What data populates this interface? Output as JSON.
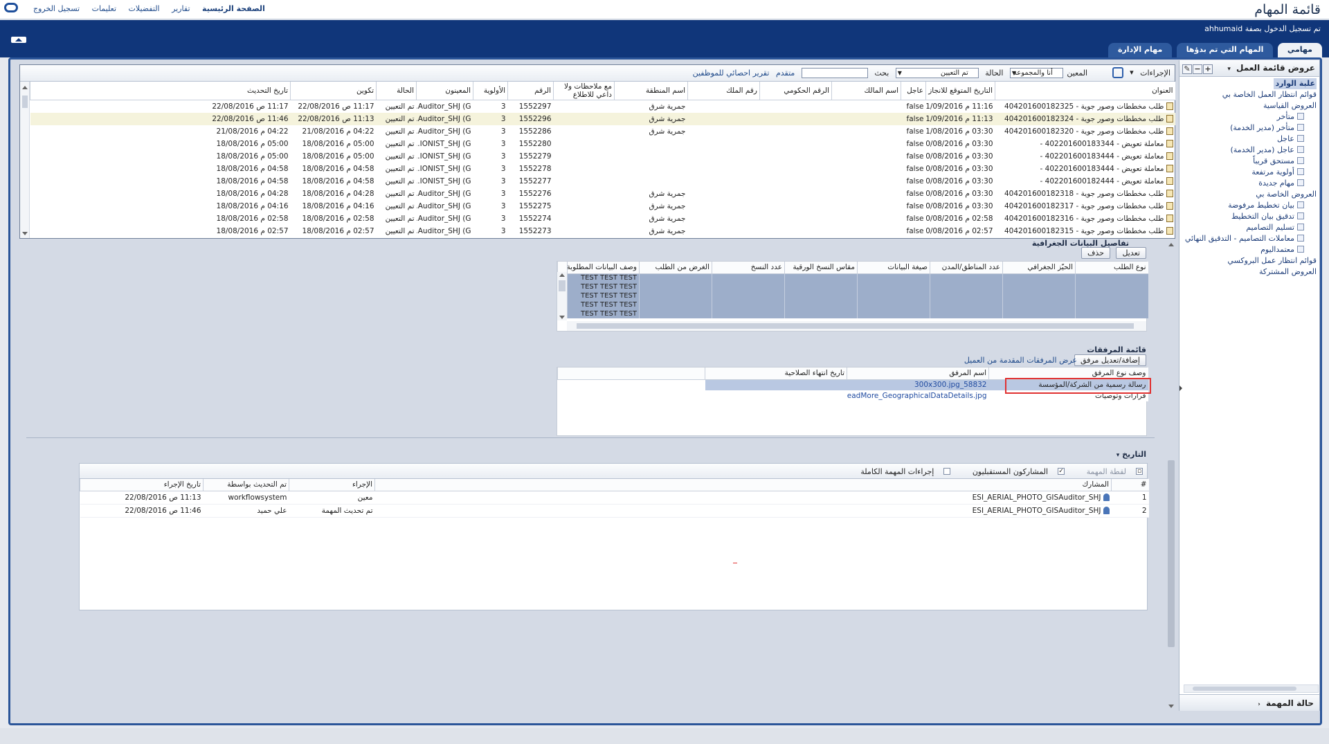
{
  "header": {
    "app_title": "قائمة المهام",
    "nav": [
      "الصفحة الرئيسية",
      "تقارير",
      "التفضيلات",
      "تعليمات",
      "تسجيل الخروج"
    ],
    "login_text": "تم تسجيل الدخول بصفة ahhumaid"
  },
  "tabs": [
    "مهامي",
    "المهام التي تم بدؤها",
    "مهام الإدارة"
  ],
  "right_panel": {
    "title": "عروض قائمة العمل",
    "inbox": "علبة الوارد",
    "my_work_queues": "قوائم انتظار العمل الخاصة بي",
    "standard_views": "العروض القياسية",
    "standard_items": [
      "متأخر",
      "متأخر (مدير الخدمة)",
      "عاجل",
      "عاجل (مدير الخدمة)",
      "مستحق قريباً",
      "أولوية مرتفعة",
      "مهام جديدة"
    ],
    "my_views": "العروض الخاصة بي",
    "my_items": [
      "بيان تخطيط مرفوضة",
      "تدقيق بيان التخطيط",
      "تسليم التصاميم",
      "معاملات التصاميم - التدقيق النهائي",
      "معتمداليوم"
    ],
    "proxy_queues": "قوائم انتظار عمل البروكسي",
    "shared_views": "العروض المشتركة",
    "footer": "حالة المهمة"
  },
  "task_toolbar": {
    "actions": "الإجراءات",
    "assignee_label": "المعين",
    "assignee_value": "أنا والمجموعة",
    "status_label": "الحالة",
    "status_value": "تم التعيين",
    "search_label": "بحث",
    "advanced": "متقدم",
    "stats_report": "تقرير احصائي للموظفين"
  },
  "task_columns": [
    "العنوان",
    "التاريخ المتوقع للانجاز",
    "عاجل",
    "اسم المالك",
    "الرقم الحكومي",
    "رقم الملك",
    "اسم المنطقة",
    "مع ملاحظات ولا داعي للاطلاع",
    "الرقم",
    "الأولوية",
    "المعينون",
    "الحالة",
    "تكوين",
    "تاريخ التحديث"
  ],
  "tasks": [
    [
      "طلب مخططات وصور جوية - 404201600182325",
      "11:16 م 01/09/2016",
      "false",
      "",
      "",
      "",
      "جمرية شرق",
      "",
      "1552297",
      "3",
      "Auditor_SHJ (G...",
      "تم التعيين",
      "11:17 ص 22/08/2016",
      "11:17 ص 22/08/2016"
    ],
    [
      "طلب مخططات وصور جوية - 404201600182324",
      "11:13 م 01/09/2016",
      "false",
      "",
      "",
      "",
      "جمرية شرق",
      "",
      "1552296",
      "3",
      "Auditor_SHJ (G...",
      "تم التعيين",
      "11:13 ص 22/08/2016",
      "11:46 ص 22/08/2016"
    ],
    [
      "طلب مخططات وصور جوية - 404201600182320",
      "03:30 م 31/08/2016",
      "false",
      "",
      "",
      "",
      "جمرية شرق",
      "",
      "1552286",
      "3",
      "Auditor_SHJ (G...",
      "تم التعيين",
      "04:22 م 21/08/2016",
      "04:22 م 21/08/2016"
    ],
    [
      "معاملة تعويض - 402201600183344 -",
      "03:30 م 30/08/2016",
      "false",
      "",
      "",
      "",
      "",
      "",
      "1552280",
      "3",
      "IONIST_SHJ (G...",
      "تم التعيين",
      "05:00 م 18/08/2016",
      "05:00 م 18/08/2016"
    ],
    [
      "معاملة تعويض - 402201600183444 -",
      "03:30 م 30/08/2016",
      "false",
      "",
      "",
      "",
      "",
      "",
      "1552279",
      "3",
      "IONIST_SHJ (G...",
      "تم التعيين",
      "05:00 م 18/08/2016",
      "05:00 م 18/08/2016"
    ],
    [
      "معاملة تعويض - 402201600183444 -",
      "03:30 م 30/08/2016",
      "false",
      "",
      "",
      "",
      "",
      "",
      "1552278",
      "3",
      "IONIST_SHJ (G...",
      "تم التعيين",
      "04:58 م 18/08/2016",
      "04:58 م 18/08/2016"
    ],
    [
      "معاملة تعويض - 402201600182444 -",
      "03:30 م 30/08/2016",
      "false",
      "",
      "",
      "",
      "",
      "",
      "1552277",
      "3",
      "IONIST_SHJ (G...",
      "تم التعيين",
      "04:58 م 18/08/2016",
      "04:58 م 18/08/2016"
    ],
    [
      "طلب مخططات وصور جوية - 404201600182318",
      "03:30 م 30/08/2016",
      "false",
      "",
      "",
      "",
      "جمرية شرق",
      "",
      "1552276",
      "3",
      "Auditor_SHJ (G...",
      "تم التعيين",
      "04:28 م 18/08/2016",
      "04:28 م 18/08/2016"
    ],
    [
      "طلب مخططات وصور جوية - 404201600182317",
      "03:30 م 30/08/2016",
      "false",
      "",
      "",
      "",
      "جمرية شرق",
      "",
      "1552275",
      "3",
      "Auditor_SHJ (G...",
      "تم التعيين",
      "04:16 م 18/08/2016",
      "04:16 م 18/08/2016"
    ],
    [
      "طلب مخططات وصور جوية - 404201600182316",
      "02:58 م 30/08/2016",
      "false",
      "",
      "",
      "",
      "جمرية شرق",
      "",
      "1552274",
      "3",
      "Auditor_SHJ (G...",
      "تم التعيين",
      "02:58 م 18/08/2016",
      "02:58 م 18/08/2016"
    ],
    [
      "طلب مخططات وصور جوية - 404201600182315",
      "02:57 م 30/08/2016",
      "false",
      "",
      "",
      "",
      "جمرية شرق",
      "",
      "1552273",
      "3",
      "Auditor_SHJ (G...",
      "تم التعيين",
      "02:57 م 18/08/2016",
      "02:57 م 18/08/2016"
    ]
  ],
  "geo": {
    "title": "تفاصيل البيانات الجغرافية",
    "edit": "تعديل",
    "delete": "حذف",
    "columns": [
      "نوع الطلب",
      "الحيّز الجغرافي",
      "عدد المناطق/المدن",
      "صيغة البيانات",
      "مقاس النسخ الورقية",
      "عدد النسخ",
      "الغرض من الطلب",
      "وصف البيانات المطلوبة"
    ],
    "rows": [
      "TEST TEST TEST",
      "TEST TEST TEST",
      "TEST TEST TEST",
      "TEST TEST TEST",
      "TEST TEST TEST"
    ]
  },
  "attachments": {
    "title": "قائمة المرفقات",
    "add_btn": "إضافة/تعديل مرفق",
    "client_link": "عرض المرفقات المقدمة من العميل",
    "columns": [
      "وصف نوع المرفق",
      "اسم المرفق",
      "تاريخ انتهاء الصلاحية"
    ],
    "rows": [
      [
        "رسالة رسمية من الشركة/المؤسسة",
        "300x300.jpg_58832",
        ""
      ],
      [
        "قرارات وتوصيات",
        "ReadMore_GeographicalDataDetails.jpg",
        ""
      ]
    ]
  },
  "history": {
    "title": "التاريخ",
    "snapshot": "لقطة المهمة",
    "future": "المشاركون المستقبليون",
    "full_actions": "إجراءات المهمة الكاملة",
    "columns": [
      "#",
      "المشارك",
      "الإجراء",
      "تم التحديث بواسطة",
      "تاريخ الإجراء"
    ],
    "rows": [
      [
        "1",
        "ESI_AERIAL_PHOTO_GISAuditor_SHJ",
        "معين",
        "workflowsystem",
        "11:13 ص 22/08/2016"
      ],
      [
        "2",
        "ESI_AERIAL_PHOTO_GISAuditor_SHJ",
        "تم تحديث المهمة",
        "علي حميد",
        "11:46 ص 22/08/2016"
      ]
    ]
  }
}
